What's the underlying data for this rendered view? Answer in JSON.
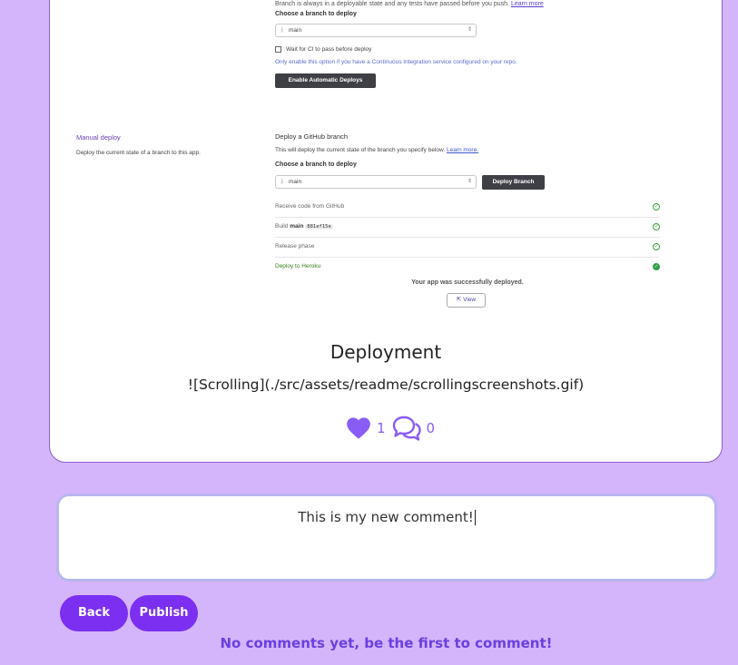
{
  "screenshot": {
    "auto_deploy": {
      "desc_prefix": "Branch is always in a deployable state and any tests have passed before you push.",
      "desc_link": "Learn more",
      "choose_label": "Choose a branch to deploy",
      "branch_value": "main",
      "wait_ci_label": "Wait for CI to pass before deploy",
      "ci_note": "Only enable this option if you have a Continuous Integration service configured on your repo.",
      "enable_button": "Enable Automatic Deploys"
    },
    "manual_deploy": {
      "title": "Manual deploy",
      "desc": "Deploy the current state of a branch to this app.",
      "github_title": "Deploy a GitHub branch",
      "github_desc": "This will deploy the current state of the branch you specify below.",
      "github_link": "Learn more.",
      "choose_label": "Choose a branch to deploy",
      "branch_value": "main",
      "deploy_button": "Deploy Branch",
      "steps": [
        {
          "label": "Receive code from GitHub"
        },
        {
          "label_prefix": "Build",
          "branch": "main",
          "commit": "881ef15e"
        },
        {
          "label": "Release phase"
        },
        {
          "label": "Deploy to Heroku"
        }
      ],
      "success_msg": "Your app was successfully deployed.",
      "view_button": "View"
    }
  },
  "post": {
    "title": "Deployment",
    "body": "![Scrolling](./src/assets/readme/scrollingscreenshots.gif)",
    "likes": "1",
    "comments": "0"
  },
  "comment_form": {
    "value": "This is my new comment!",
    "back_label": "Back",
    "publish_label": "Publish"
  },
  "empty_comments_msg": "No comments yet, be the first to comment!",
  "colors": {
    "background": "#d4b5fb",
    "accent": "#7b2ff0",
    "icon": "#8a5cf6"
  }
}
